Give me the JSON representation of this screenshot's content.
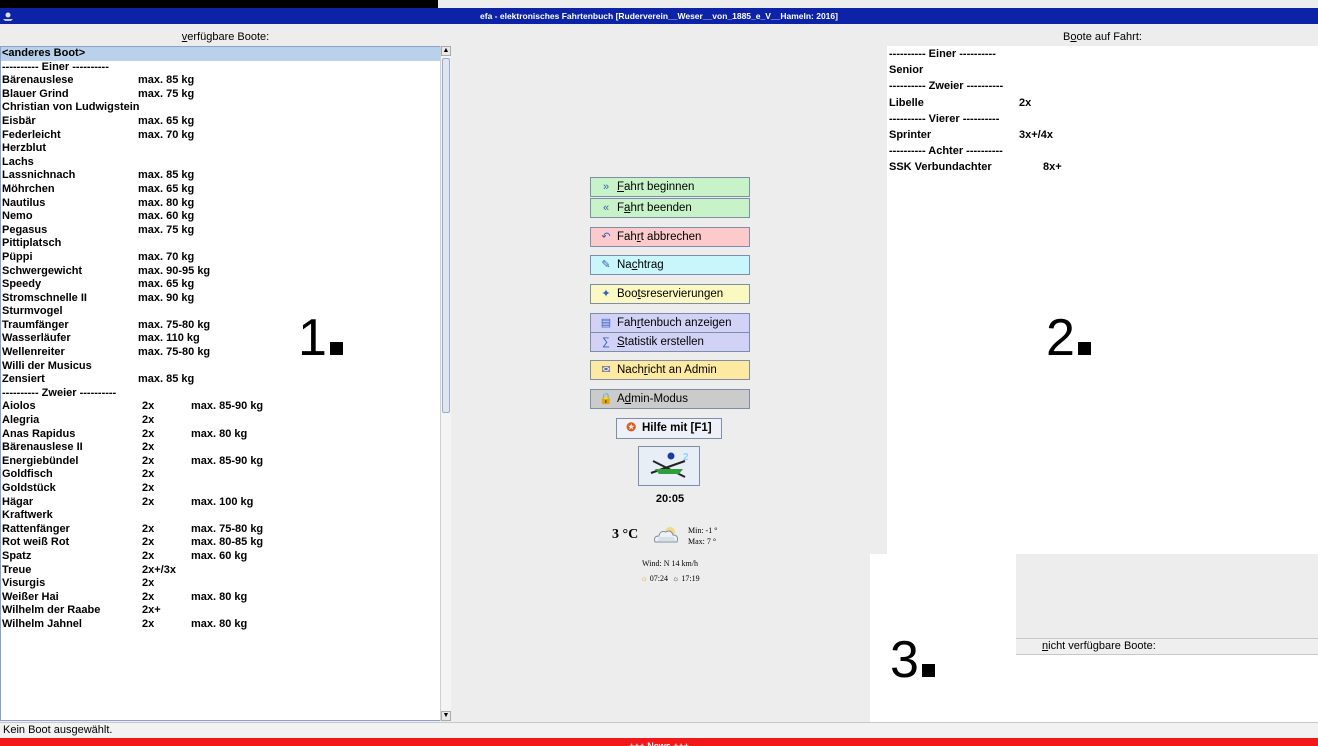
{
  "window": {
    "title": "efa - elektronisches Fahrtenbuch [Ruderverein__Weser__von_1885_e_V__Hameln: 2016]"
  },
  "left_panel": {
    "header_pre": "",
    "header_u": "v",
    "header_post": "erfügbare Boote:",
    "rows": [
      {
        "name": "<anderes Boot>",
        "col2": "",
        "col3": ""
      },
      {
        "name": "---------- Einer ----------",
        "col2": "",
        "col3": ""
      },
      {
        "name": "Bärenauslese",
        "col2": "max. 85 kg",
        "col3": ""
      },
      {
        "name": "Blauer Grind",
        "col2": "max. 75 kg",
        "col3": ""
      },
      {
        "name": "Christian von Ludwigstein",
        "col2": "",
        "col3": ""
      },
      {
        "name": "Eisbär",
        "col2": "max. 65 kg",
        "col3": ""
      },
      {
        "name": "Federleicht",
        "col2": "max. 70 kg",
        "col3": ""
      },
      {
        "name": "Herzblut",
        "col2": "",
        "col3": ""
      },
      {
        "name": "Lachs",
        "col2": "",
        "col3": ""
      },
      {
        "name": "Lassnichnach",
        "col2": "max. 85 kg",
        "col3": ""
      },
      {
        "name": "Möhrchen",
        "col2": "max. 65 kg",
        "col3": ""
      },
      {
        "name": "Nautilus",
        "col2": "max. 80 kg",
        "col3": ""
      },
      {
        "name": "Nemo",
        "col2": "max. 60 kg",
        "col3": ""
      },
      {
        "name": "Pegasus",
        "col2": "max. 75 kg",
        "col3": ""
      },
      {
        "name": "Pittiplatsch",
        "col2": "",
        "col3": ""
      },
      {
        "name": "Püppi",
        "col2": "max. 70 kg",
        "col3": ""
      },
      {
        "name": "Schwergewicht",
        "col2": "max. 90-95 kg",
        "col3": ""
      },
      {
        "name": "Speedy",
        "col2": "max. 65 kg",
        "col3": ""
      },
      {
        "name": "Stromschnelle II",
        "col2": "max. 90 kg",
        "col3": ""
      },
      {
        "name": "Sturmvogel",
        "col2": "",
        "col3": ""
      },
      {
        "name": "Traumfänger",
        "col2": "max. 75-80 kg",
        "col3": ""
      },
      {
        "name": "Wasserläufer",
        "col2": "max. 110 kg",
        "col3": ""
      },
      {
        "name": "Wellenreiter",
        "col2": "max. 75-80 kg",
        "col3": ""
      },
      {
        "name": "Willi der Musicus",
        "col2": "",
        "col3": ""
      },
      {
        "name": "Zensiert",
        "col2": "max. 85 kg",
        "col3": ""
      },
      {
        "name": "---------- Zweier ----------",
        "col2": "",
        "col3": ""
      },
      {
        "name": "Aiolos",
        "col2": "2x",
        "col3": "max. 85-90 kg"
      },
      {
        "name": "Alegria",
        "col2": "2x",
        "col3": ""
      },
      {
        "name": "Anas Rapidus",
        "col2": "2x",
        "col3": "max. 80 kg"
      },
      {
        "name": "Bärenauslese II",
        "col2": "2x",
        "col3": ""
      },
      {
        "name": "Energiebündel",
        "col2": "2x",
        "col3": "max. 85-90 kg"
      },
      {
        "name": "Goldfisch",
        "col2": "2x",
        "col3": ""
      },
      {
        "name": "Goldstück",
        "col2": "2x",
        "col3": ""
      },
      {
        "name": "Hägar",
        "col2": "2x",
        "col3": "max. 100 kg"
      },
      {
        "name": "Kraftwerk",
        "col2": "",
        "col3": ""
      },
      {
        "name": "Rattenfänger",
        "col2": "2x",
        "col3": "max. 75-80 kg"
      },
      {
        "name": "Rot weiß Rot",
        "col2": "2x",
        "col3": "max. 80-85 kg"
      },
      {
        "name": "Spatz",
        "col2": "2x",
        "col3": "max. 60 kg"
      },
      {
        "name": "Treue",
        "col2": "2x+/3x",
        "col3": ""
      },
      {
        "name": "Visurgis",
        "col2": "2x",
        "col3": ""
      },
      {
        "name": "Weißer Hai",
        "col2": "2x",
        "col3": "max. 80 kg"
      },
      {
        "name": "Wilhelm der Raabe",
        "col2": "2x+",
        "col3": ""
      },
      {
        "name": "Wilhelm Jahnel",
        "col2": "2x",
        "col3": "max. 80 kg"
      }
    ]
  },
  "buttons": [
    {
      "id": "fahrt-beginnen",
      "icon": "»",
      "icon_name": "double-chevron-right-icon",
      "pre": "",
      "u": "F",
      "post": "ahrt beginnen",
      "color": "green"
    },
    {
      "id": "fahrt-beenden",
      "icon": "«",
      "icon_name": "double-chevron-left-icon",
      "pre": "F",
      "u": "a",
      "post": "hrt beenden",
      "color": "green"
    },
    {
      "id": "fahrt-abbrechen",
      "icon": "↶",
      "icon_name": "undo-icon",
      "pre": "Fah",
      "u": "r",
      "post": "t abbrechen",
      "color": "red"
    },
    {
      "id": "nachtrag",
      "icon": "✎",
      "icon_name": "edit-icon",
      "pre": "Na",
      "u": "c",
      "post": "htrag",
      "color": "cyan"
    },
    {
      "id": "bootsreservierungen",
      "icon": "✦",
      "icon_name": "reservation-icon",
      "pre": "Boo",
      "u": "t",
      "post": "sreservierungen",
      "color": "yellow"
    },
    {
      "id": "fahrtenbuch-anzeigen",
      "icon": "▤",
      "icon_name": "logbook-icon",
      "pre": "Fah",
      "u": "r",
      "post": "tenbuch anzeigen",
      "color": "lav"
    },
    {
      "id": "statistik-erstellen",
      "icon": "∑",
      "icon_name": "sigma-icon",
      "pre": "",
      "u": "S",
      "post": "tatistik erstellen",
      "color": "lav"
    },
    {
      "id": "nachricht-an-admin",
      "icon": "✉",
      "icon_name": "mail-icon",
      "pre": "Nach",
      "u": "r",
      "post": "icht an Admin",
      "color": "ylw2"
    },
    {
      "id": "admin-modus",
      "icon": "🔒",
      "icon_name": "lock-icon",
      "pre": "A",
      "u": "d",
      "post": "min-Modus",
      "color": "grey"
    }
  ],
  "help_button": {
    "label": "Hilfe mit [F1]",
    "icon": "✪"
  },
  "clock": "20:05",
  "weather": {
    "temp": "3 °C",
    "min": "Min: -1 °",
    "max": "Max: 7 °",
    "wind": "Wind: N 14 km/h",
    "sunrise": "07:24",
    "sunset": "17:19"
  },
  "right_panel": {
    "header_pre": "B",
    "header_u": "o",
    "header_post": "ote auf Fahrt:",
    "rows": [
      {
        "name": "---------- Einer ----------",
        "col2": ""
      },
      {
        "name": "Senior",
        "col2": ""
      },
      {
        "name": "---------- Zweier ----------",
        "col2": ""
      },
      {
        "name": "Libelle",
        "col2": "2x"
      },
      {
        "name": "---------- Vierer ----------",
        "col2": ""
      },
      {
        "name": "Sprinter",
        "col2": "3x+/4x"
      },
      {
        "name": "---------- Achter ----------",
        "col2": ""
      },
      {
        "name": "SSK Verbundachter",
        "col2": "8x+"
      }
    ]
  },
  "unavailable": {
    "header_pre": "",
    "header_u": "n",
    "header_post": "icht verfügbare Boote:"
  },
  "annotations": {
    "one": "1",
    "two": "2",
    "three": "3"
  },
  "status_text": "Kein Boot ausgewählt.",
  "news_text": "+++ News +++",
  "colors": {
    "titlebar": "#0c23a8",
    "selection": "#b9d1ea",
    "news": "#f01818"
  }
}
